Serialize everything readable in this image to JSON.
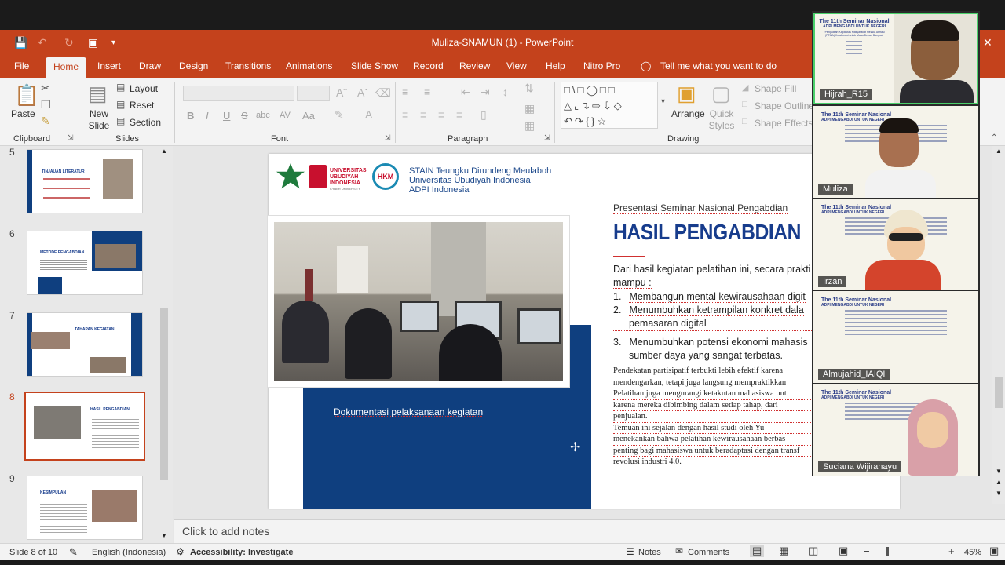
{
  "window": {
    "title": "Muliza-SNAMUN (1)  -  PowerPoint"
  },
  "menu_tabs": [
    "File",
    "Home",
    "Insert",
    "Draw",
    "Design",
    "Transitions",
    "Animations",
    "Slide Show",
    "Record",
    "Review",
    "View",
    "Help",
    "Nitro Pro"
  ],
  "tell_me": "Tell me what you want to do",
  "ribbon": {
    "clipboard": {
      "paste": "Paste",
      "label": "Clipboard"
    },
    "slides": {
      "new_slide": "New Slide",
      "layout": "Layout",
      "reset": "Reset",
      "section": "Section",
      "label": "Slides"
    },
    "font": {
      "label": "Font",
      "bold": "B",
      "italic": "I",
      "underline": "U",
      "strike": "S",
      "shadow": "abc",
      "spacing": "AV",
      "case": "Aa"
    },
    "paragraph": {
      "label": "Paragraph"
    },
    "drawing": {
      "arrange": "Arrange",
      "quick_styles": "Quick Styles",
      "shape_fill": "Shape Fill",
      "shape_outline": "Shape Outline",
      "shape_effects": "Shape Effects",
      "label": "Drawing"
    }
  },
  "thumbnails": [
    {
      "num": "5",
      "title": "TINJAUAN LITERATUR"
    },
    {
      "num": "6",
      "title": "METODE PENGABDIAN"
    },
    {
      "num": "7",
      "title": "TAHAPAN KEGIATAN"
    },
    {
      "num": "8",
      "title": "HASIL PENGABDIAN"
    },
    {
      "num": "9",
      "title": "KESIMPULAN"
    }
  ],
  "slide": {
    "org_lines": [
      "STAIN Teungku Dirundeng Meulaboh",
      "Universitas Ubudiyah Indonesia",
      "ADPI Indonesia"
    ],
    "logo_text": "UNIVERSITAS UBUDIYAH INDONESIA",
    "logo_sub": "CYBER UNIVERSITY",
    "hkm": "HKM",
    "caption": "Dokumentasi pelaksanaan kegiatan",
    "subtitle": "Presentasi Seminar Nasional Pengabdian",
    "title": "HASIL PENGABDIAN",
    "intro": "Dari hasil kegiatan pelatihan ini, secara prakti",
    "intro2": "mampu :",
    "points": [
      {
        "n": "1.",
        "text": "Membangun mental kewirausahaan digit"
      },
      {
        "n": "2.",
        "text": "Menumbuhkan ketrampilan konkret dala",
        "cont": "pemasaran digital"
      },
      {
        "n": "3.",
        "text": "Menumbuhkan potensi ekonomi mahasis",
        "cont": "sumber daya yang sangat terbatas."
      }
    ],
    "para": [
      "Pendekatan partisipatif terbukti lebih efektif karena",
      "mendengarkan, tetapi juga langsung mempraktikkan",
      "Pelatihan juga mengurangi ketakutan mahasiswa unt",
      "karena mereka dibimbing dalam setiap tahap, dari",
      "penjualan.",
      "Temuan ini sejalan dengan hasil studi oleh Yu",
      "menekankan bahwa pelatihan kewirausahaan berbas",
      "penting bagi mahasiswa untuk beradaptasi dengan transf",
      "revolusi industri 4.0."
    ]
  },
  "notes_placeholder": "Click to add notes",
  "status": {
    "slide": "Slide 8 of 10",
    "language": "English (Indonesia)",
    "accessibility": "Accessibility: Investigate",
    "notes": "Notes",
    "comments": "Comments",
    "zoom": "45%"
  },
  "participants": [
    {
      "name": "Hijrah_R15",
      "active": true
    },
    {
      "name": "Muliza"
    },
    {
      "name": "Irzan"
    },
    {
      "name": "Almujahid_IAIQI"
    },
    {
      "name": "Suciana Wijirahayu"
    }
  ],
  "poster": {
    "title": "The 11th Seminar Nasional",
    "sub": "ADPI MENGABDI UNTUK NEGERI",
    "theme": "\"Penguatan Kapasitas Masyarakat melalui Abrtasi (PTMA) Kolaborasi untuk Masa Depan Bangsa\""
  },
  "colors": {
    "accent": "#c4421c",
    "slide_blue": "#0f3f7f",
    "title_blue": "#173c8c",
    "active_speaker": "#4bd06b"
  }
}
